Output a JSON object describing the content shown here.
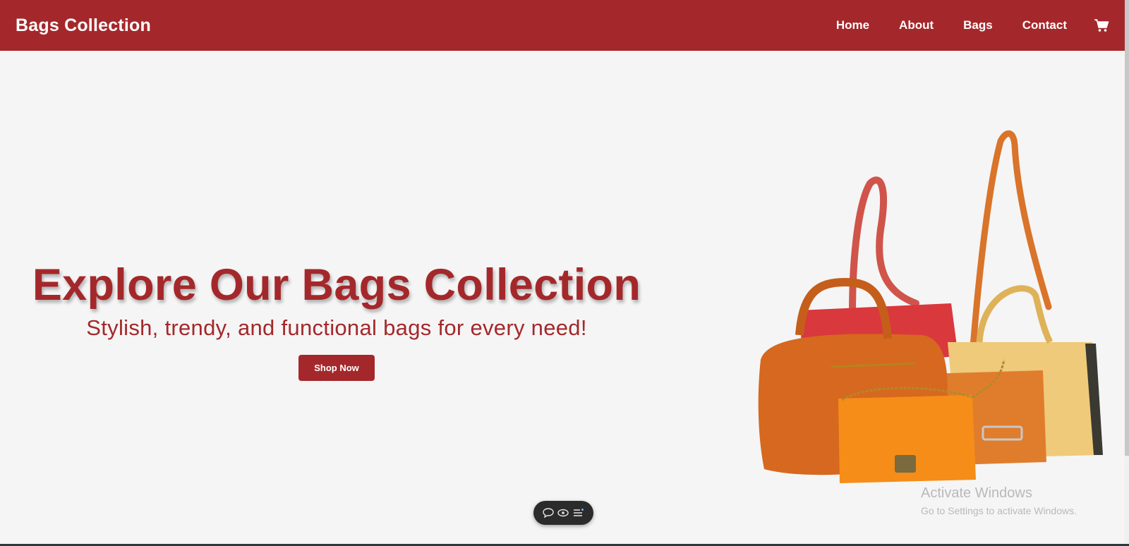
{
  "navbar": {
    "brand": "Bags Collection",
    "links": [
      "Home",
      "About",
      "Bags",
      "Contact"
    ],
    "cart_icon": "shopping-cart-icon",
    "background": "#a4282b"
  },
  "hero": {
    "title": "Explore Our Bags Collection",
    "subtitle": "Stylish, trendy, and functional bags for every need!",
    "button_label": "Shop Now",
    "accent": "#a4282b"
  },
  "toolbar": {
    "icons": [
      "chat-bubble-icon",
      "eye-icon",
      "list-sparkle-icon"
    ]
  },
  "watermark": {
    "title": "Activate Windows",
    "subtitle": "Go to Settings to activate Windows."
  }
}
